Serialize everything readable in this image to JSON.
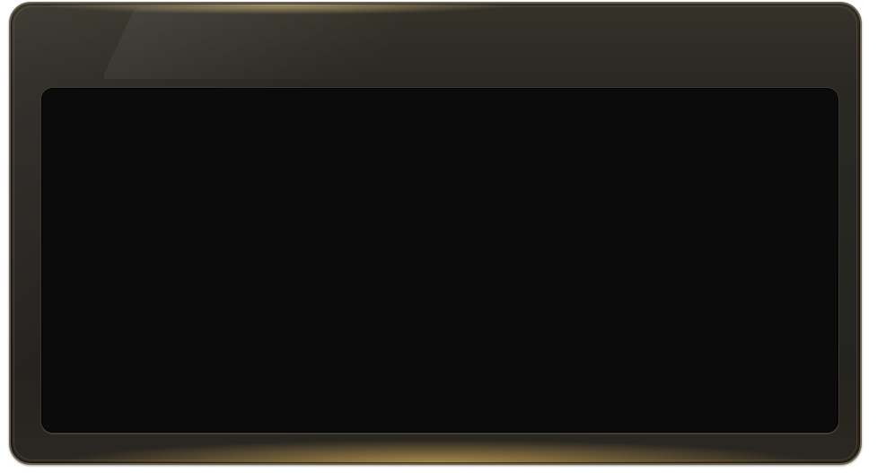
{
  "panel": {
    "colors": {
      "bezel": "#2a2823",
      "bezel_edge": "#6b624e",
      "glow": "#ebbe5f",
      "screen": "#0b0b0b"
    }
  }
}
